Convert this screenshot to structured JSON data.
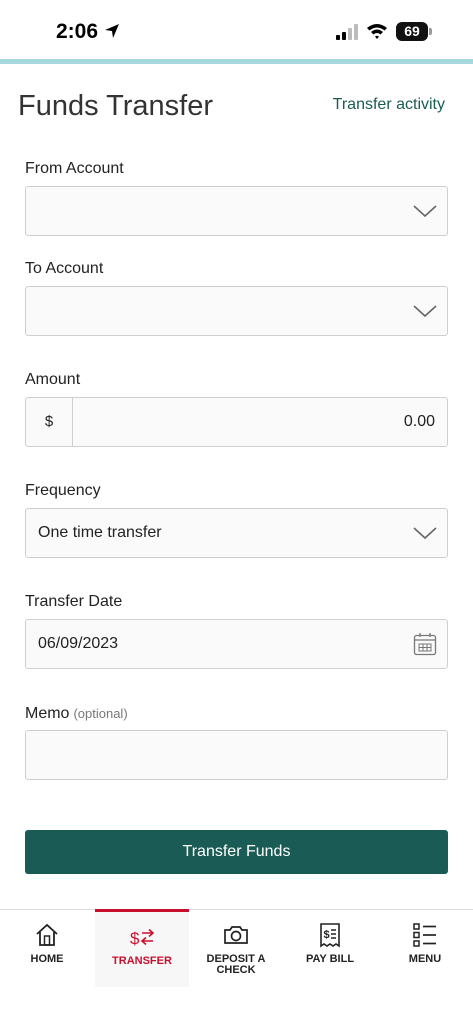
{
  "status": {
    "time": "2:06",
    "battery": "69"
  },
  "header": {
    "title": "Funds Transfer",
    "activity_link": "Transfer activity"
  },
  "form": {
    "from_account": {
      "label": "From Account",
      "value": ""
    },
    "to_account": {
      "label": "To Account",
      "value": ""
    },
    "amount": {
      "label": "Amount",
      "currency": "$",
      "value": "0.00"
    },
    "frequency": {
      "label": "Frequency",
      "value": "One time transfer"
    },
    "transfer_date": {
      "label": "Transfer Date",
      "value": "06/09/2023"
    },
    "memo": {
      "label": "Memo",
      "optional_hint": "(optional)",
      "value": ""
    },
    "submit_label": "Transfer Funds"
  },
  "nav": {
    "items": [
      {
        "label": "HOME",
        "icon": "home-icon"
      },
      {
        "label": "TRANSFER",
        "icon": "transfer-icon",
        "active": true
      },
      {
        "label": "DEPOSIT A CHECK",
        "icon": "camera-icon"
      },
      {
        "label": "PAY BILL",
        "icon": "bill-icon"
      },
      {
        "label": "MENU",
        "icon": "menu-list-icon"
      }
    ]
  },
  "colors": {
    "accent": "#1a5c55",
    "active_nav": "#c8102e",
    "status_line": "#a8d8df"
  }
}
